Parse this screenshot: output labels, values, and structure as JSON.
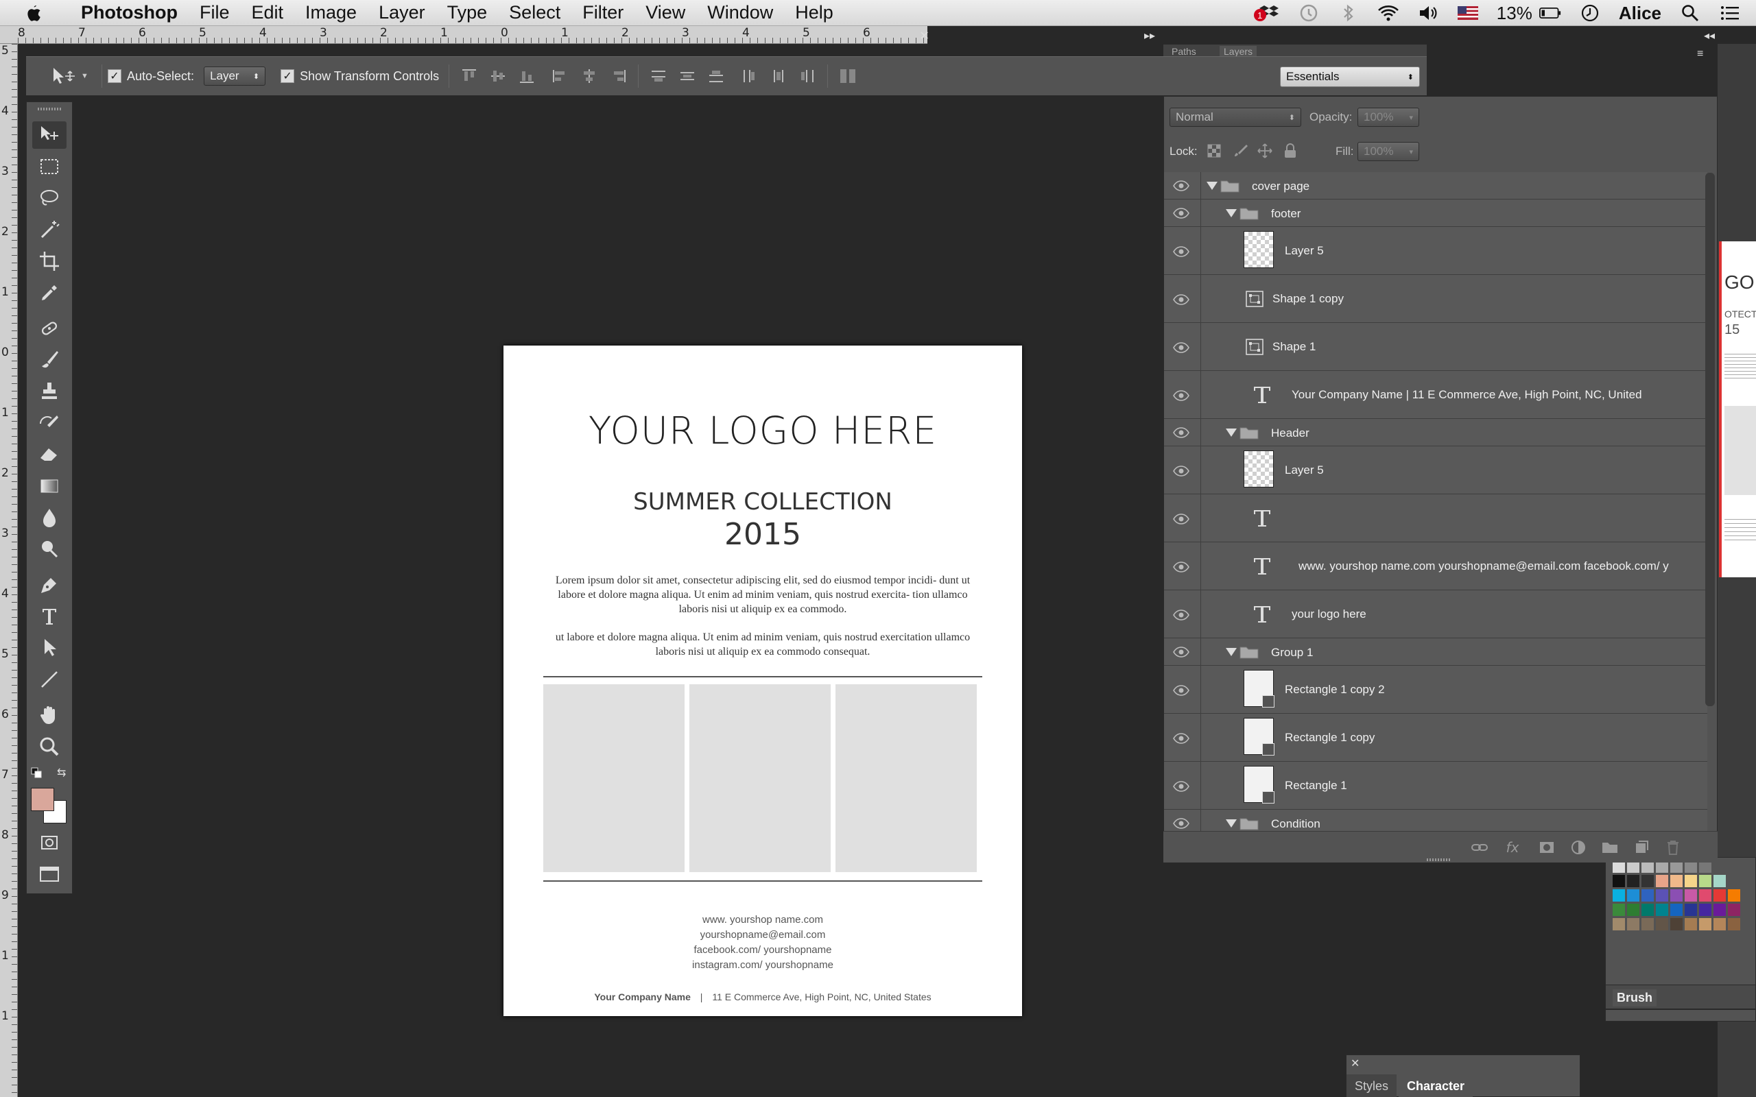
{
  "menubar": {
    "app_name": "Photoshop",
    "menus": [
      "File",
      "Edit",
      "Image",
      "Layer",
      "Type",
      "Select",
      "Filter",
      "View",
      "Window",
      "Help"
    ],
    "battery": "13%",
    "user": "Alice",
    "notification_badge": "1",
    "icons": [
      "dropbox-icon",
      "time-machine-icon",
      "bluetooth-icon",
      "wifi-icon",
      "volume-icon",
      "us-flag-icon",
      "battery-icon",
      "clock-icon",
      "spotlight-icon",
      "notification-center-icon"
    ]
  },
  "ruler": {
    "h_numbers": [
      "8",
      "7",
      "6",
      "5",
      "4",
      "3",
      "2",
      "1",
      "0",
      "1",
      "2",
      "3",
      "4",
      "5",
      "6"
    ],
    "v_numbers": [
      "5",
      "4",
      "3",
      "2",
      "1",
      "0",
      "1",
      "2",
      "3",
      "4",
      "5",
      "6",
      "7",
      "8",
      "9",
      "1",
      "1"
    ]
  },
  "options_bar": {
    "auto_select_label": "Auto-Select:",
    "auto_select_checked": true,
    "auto_select_value": "Layer",
    "show_transform_label": "Show Transform Controls",
    "show_transform_checked": true,
    "workspace_value": "Essentials"
  },
  "toolbox": {
    "tools": [
      "move-tool",
      "rectangular-marquee-tool",
      "lasso-tool",
      "magic-wand-tool",
      "crop-tool",
      "eyedropper-tool",
      "spot-healing-brush-tool",
      "brush-tool",
      "clone-stamp-tool",
      "history-brush-tool",
      "eraser-tool",
      "gradient-tool",
      "blur-tool",
      "dodge-tool",
      "pen-tool",
      "type-tool",
      "path-selection-tool",
      "line-tool",
      "hand-tool",
      "zoom-tool"
    ],
    "foreground_color": "#d9a79b",
    "background_color": "#ffffff"
  },
  "document": {
    "logo_text": "YOUR LOGO HERE",
    "collection_title": "SUMMER COLLECTION",
    "collection_year": "2015",
    "paragraph1": "Lorem ipsum dolor sit amet, consectetur adipiscing elit, sed do eiusmod tempor incidi- dunt ut labore et dolore magna aliqua. Ut enim ad minim veniam, quis nostrud exercita- tion ullamco laboris nisi ut aliquip ex ea commodo.",
    "paragraph2": "ut labore et dolore magna aliqua. Ut enim ad minim veniam, quis nostrud exercitation ullamco laboris nisi ut aliquip ex ea commodo consequat.",
    "contact": [
      "www. yourshop name.com",
      "yourshopname@email.com",
      "facebook.com/ yourshopname",
      "instagram.com/ yourshopname"
    ],
    "company_name": "Your Company Name",
    "company_sep": "|",
    "company_address": "11 E Commerce Ave, High Point, NC, United States"
  },
  "layers_panel": {
    "blend_mode": "Normal",
    "opacity_label": "Opacity:",
    "opacity_value": "100%",
    "lock_label": "Lock:",
    "fill_label": "Fill:",
    "fill_value": "100%",
    "layers": [
      {
        "name": "cover page",
        "kind": "group",
        "level": 0
      },
      {
        "name": "footer",
        "kind": "group",
        "level": 1
      },
      {
        "name": "Layer 5",
        "kind": "pixel",
        "level": 2
      },
      {
        "name": "Shape 1 copy",
        "kind": "shape",
        "level": 2
      },
      {
        "name": "Shape 1",
        "kind": "shape",
        "level": 2
      },
      {
        "name": "Your Company Name  |  11 E Commerce Ave, High Point, NC, United",
        "kind": "text",
        "level": 2
      },
      {
        "name": "Header",
        "kind": "group",
        "level": 1
      },
      {
        "name": "Layer 5",
        "kind": "pixel",
        "level": 2
      },
      {
        "name": "",
        "kind": "text",
        "level": 2
      },
      {
        "name": "www. yourshop name.com yourshopname@email.com facebook.com/ y",
        "kind": "text",
        "level": 2
      },
      {
        "name": "your logo here",
        "kind": "text",
        "level": 2
      },
      {
        "name": "Group 1",
        "kind": "group",
        "level": 1
      },
      {
        "name": "Rectangle 1 copy 2",
        "kind": "rect",
        "level": 2
      },
      {
        "name": "Rectangle 1 copy",
        "kind": "rect",
        "level": 2
      },
      {
        "name": "Rectangle 1",
        "kind": "rect",
        "level": 2
      },
      {
        "name": "Condition",
        "kind": "group",
        "level": 1
      }
    ]
  },
  "panels": {
    "brush_tab": "Brush",
    "styles_tab": "Styles",
    "character_tab": "Character",
    "paths_tab": "Paths",
    "layers_tab": "Layers"
  },
  "peek_text": {
    "line1": "GO H",
    "line2": "OTECTI",
    "line3": "15"
  }
}
